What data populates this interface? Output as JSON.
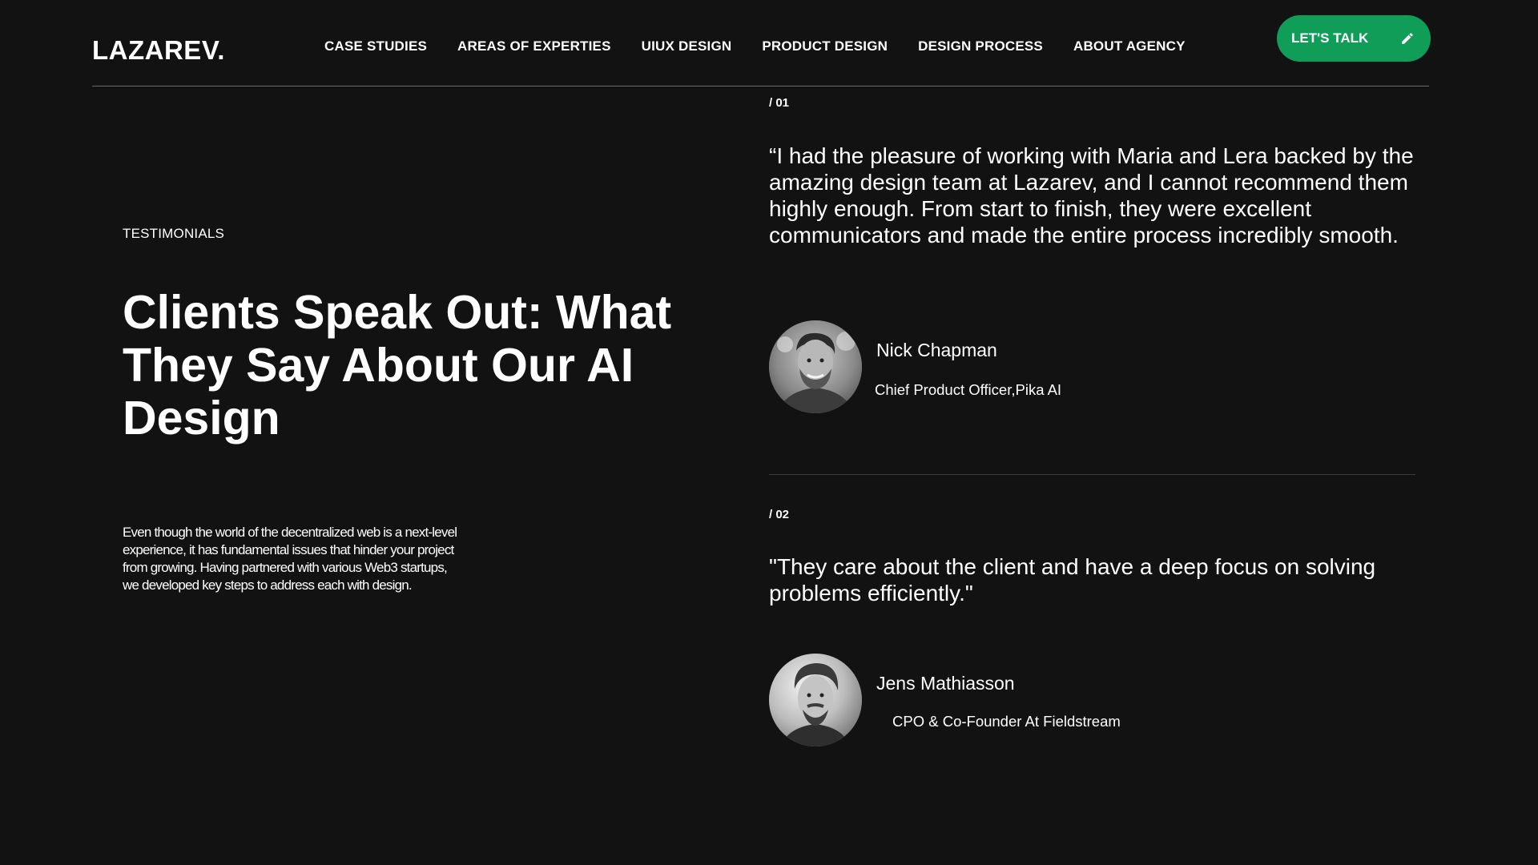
{
  "header": {
    "logo": "LAZAREV.",
    "nav": [
      "CASE STUDIES",
      "AREAS OF EXPERTIES",
      "UIUX DESIGN",
      "PRODUCT DESIGN",
      "DESIGN PROCESS",
      "ABOUT AGENCY"
    ],
    "cta_label": "LET'S TALK",
    "cta_icon": "pencil-icon",
    "accent_color": "#0f9d58"
  },
  "intro": {
    "eyebrow": "TESTIMONIALS",
    "headline": "Clients Speak Out: What They Say About Our AI Design",
    "body": "Even though the world of the decentralized web is a next-level experience, it has fundamental issues that hinder your project from growing. Having partnered with various Web3 startups, we developed key steps to address each with design."
  },
  "testimonials": [
    {
      "number": "/ 01",
      "quote": "“I had the pleasure of working with Maria and Lera backed by the amazing design team at Lazarev, and I cannot recommend them highly enough. From start to finish, they were excellent communicators and made the entire process incredibly smooth.",
      "name": "Nick Chapman",
      "role": "Chief Product Officer,Pika AI"
    },
    {
      "number": "/ 02",
      "quote": "\"They care about the client and have a deep focus on solving problems efficiently.\"",
      "name": "Jens Mathiasson",
      "role": "CPO & Co-Founder At Fieldstream"
    }
  ]
}
